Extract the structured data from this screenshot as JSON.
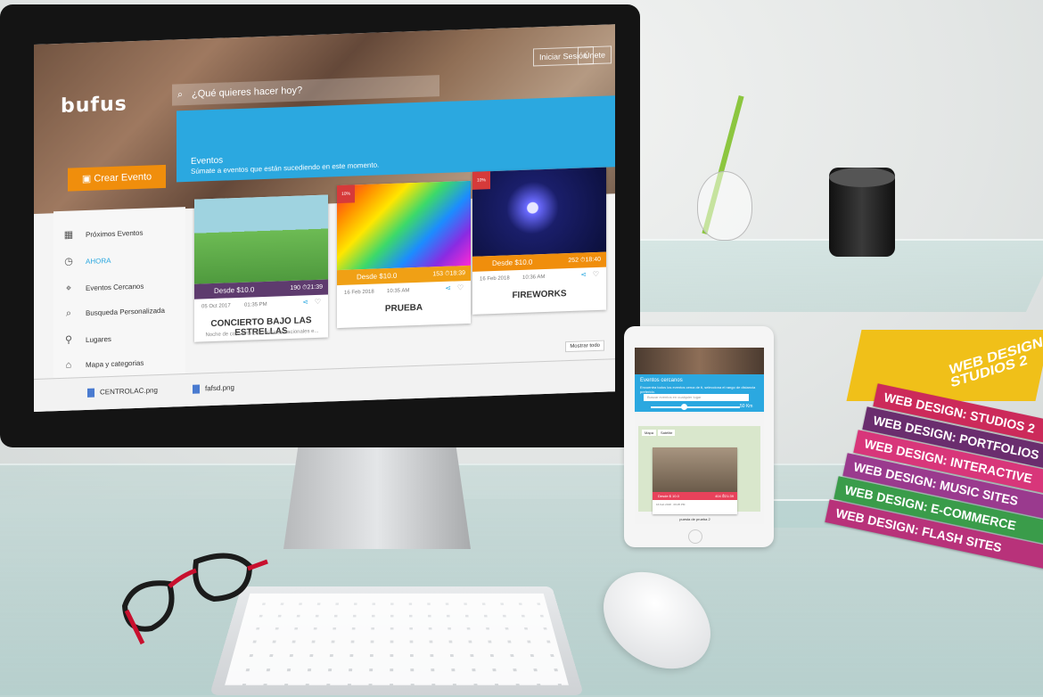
{
  "desktop": {
    "logo": "bufus",
    "search_placeholder": "¿Qué quieres hacer hoy?",
    "top_buttons": [
      "Iniciar Sesión",
      "Únete"
    ],
    "create_button": "Crear Evento",
    "banner": {
      "title": "Eventos",
      "subtitle": "Súmate a eventos que están sucediendo en este momento."
    },
    "sidebar": [
      {
        "label": "Próximos Eventos",
        "icon": "calendar-icon"
      },
      {
        "label": "AHORA",
        "icon": "clock-icon"
      },
      {
        "label": "Eventos Cercanos",
        "icon": "location-icon"
      },
      {
        "label": "Busqueda Personalizada",
        "icon": "search-icon"
      },
      {
        "label": "Lugares",
        "icon": "pin-icon"
      },
      {
        "label": "Mapa y categorias",
        "icon": "map-icon"
      }
    ],
    "cards": [
      {
        "price": "Desde $10.0",
        "stats": "190 ⏱21:39",
        "date": "05 Oct 2017",
        "time": "01:35 PM",
        "title": "CONCIERTO BAJO LAS ESTRELLAS",
        "desc": "Noche de concierto con músicos nacionales e..."
      },
      {
        "price": "Desde $10.0",
        "stats": "153 ⏱18:39",
        "date": "16 Feb 2018",
        "time": "10:35 AM",
        "title": "PRUEBA",
        "ribbon": "10%"
      },
      {
        "price": "Desde $10.0",
        "stats": "252 ⏱18:40",
        "date": "16 Feb 2018",
        "time": "10:36 AM",
        "title": "FIREWORKS",
        "ribbon": "10%"
      }
    ],
    "downloads": [
      "CENTROLAC.png",
      "fafsd.png"
    ],
    "show_all": "Mostrar todo"
  },
  "tablet": {
    "title": "Eventos cercanos",
    "subtitle": "Encuentra todos los eventos cerca de ti, selecciona el rango de distancia preferido.",
    "search_placeholder": "Buscar eventos en cualquier lugar",
    "distance": "50 Km",
    "map_tabs": [
      "Mapa",
      "Satélite"
    ],
    "card": {
      "price": "Desde $ 10.0",
      "stats": "404 ⏱21:39",
      "date": "16 Feb 2018",
      "time": "09:25 PM",
      "title": "puesta de prueba 2"
    }
  },
  "books": [
    "WEB DESIGN: STUDIOS 2",
    "WEB DESIGN: PORTFOLIOS",
    "WEB DESIGN: INTERACTIVE",
    "WEB DESIGN: MUSIC SITES",
    "WEB DESIGN: E-COMMERCE",
    "WEB DESIGN: FLASH SITES"
  ],
  "big_book": "WEB DESIGN STUDIOS 2",
  "colors": {
    "accent": "#2ba8e0",
    "create": "#f08e0c",
    "card1": "#5e3b6e",
    "card2": "#f0a015",
    "card3": "#f08e0c"
  }
}
